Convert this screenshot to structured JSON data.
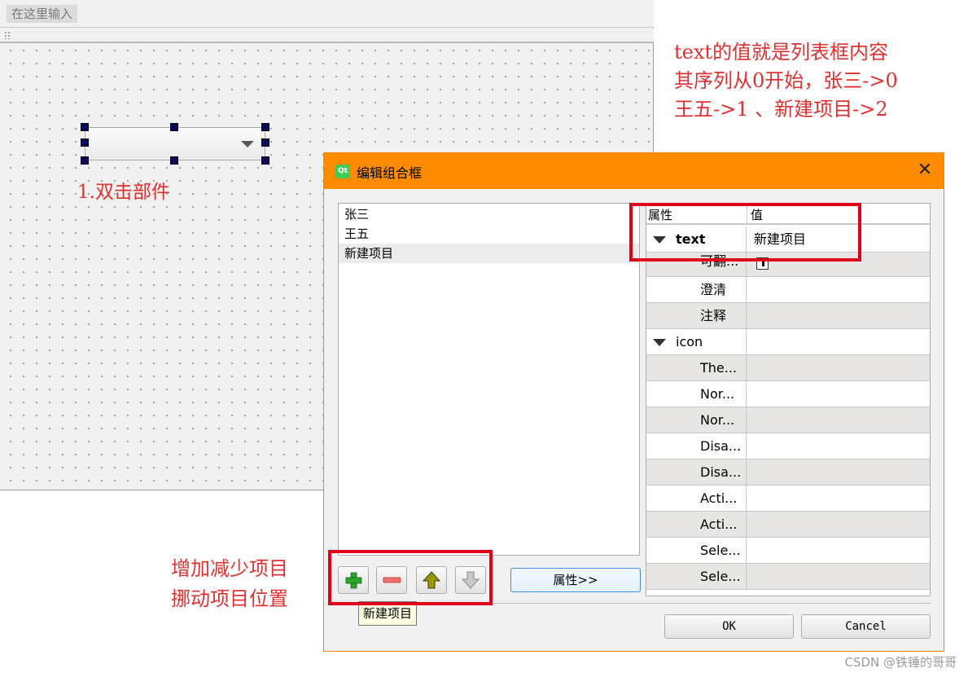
{
  "designer": {
    "menu_placeholder": "在这里输入"
  },
  "annotations": {
    "top_right": [
      "text的值就是列表框内容",
      "其序列从0开始，张三->0",
      "王五->1 、新建项目->2"
    ],
    "double_click": "1.双击部件",
    "bottom_left": [
      "增加减少项目",
      "挪动项目位置"
    ]
  },
  "dialog": {
    "title": "编辑组合框",
    "logo_text": "Qt",
    "close_icon": "✕",
    "list_items": [
      {
        "label": "张三",
        "selected": false
      },
      {
        "label": "王五",
        "selected": false
      },
      {
        "label": "新建项目",
        "selected": true
      }
    ],
    "properties": {
      "header": {
        "name": "属性",
        "value": "值"
      },
      "rows": [
        {
          "name": "text",
          "value": "新建项目"
        },
        {
          "name": "可翻...",
          "value": ""
        },
        {
          "name": "澄清",
          "value": ""
        },
        {
          "name": "注释",
          "value": ""
        },
        {
          "name": "icon",
          "value": ""
        },
        {
          "name": "The...",
          "value": ""
        },
        {
          "name": "Nor...",
          "value": ""
        },
        {
          "name": "Nor...",
          "value": ""
        },
        {
          "name": "Disa...",
          "value": ""
        },
        {
          "name": "Disa...",
          "value": ""
        },
        {
          "name": "Acti...",
          "value": ""
        },
        {
          "name": "Acti...",
          "value": ""
        },
        {
          "name": "Sele...",
          "value": ""
        },
        {
          "name": "Sele...",
          "value": ""
        }
      ]
    },
    "properties_button": "属性>>",
    "tooltip": "新建项目",
    "ok_label": "OK",
    "cancel_label": "Cancel"
  },
  "watermark": "CSDN @铁锤的哥哥",
  "colors": {
    "titlebar": "#ff8c00",
    "annotation_red": "#e03030",
    "highlight_box": "#e0001b"
  }
}
